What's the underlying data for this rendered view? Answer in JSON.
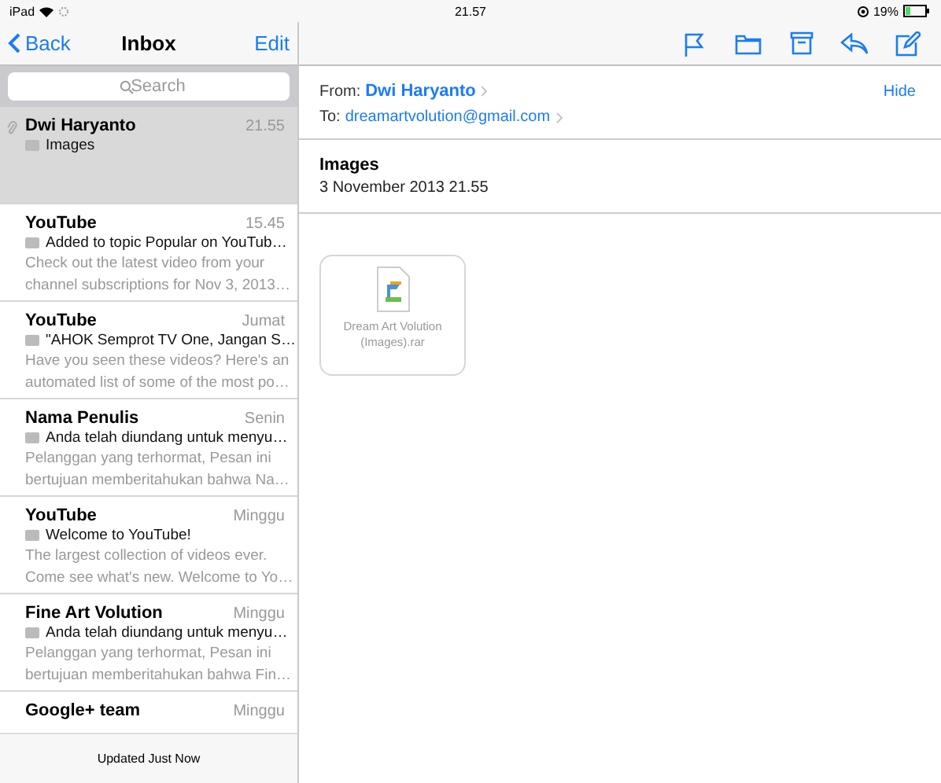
{
  "status_bar": {
    "device": "iPad",
    "time": "21.57",
    "battery": "19%"
  },
  "sidebar": {
    "back": "Back",
    "title": "Inbox",
    "edit": "Edit",
    "search": {
      "placeholder": "Search"
    },
    "messages": [
      {
        "sender": "Dwi Haryanto",
        "time": "21.55",
        "subject": "Images",
        "selected": true,
        "attachment": true
      },
      {
        "sender": "YouTube",
        "time": "15.45",
        "subject": "Added to topic Popular on YouTub…",
        "preview": [
          "Check out the latest video from your",
          "channel subscriptions for Nov 3, 2013…"
        ],
        "selected": false,
        "attachment": false
      },
      {
        "sender": "YouTube",
        "time": "Jumat",
        "subject": "\"AHOK Semprot TV One, Jangan S…",
        "preview": [
          "Have you seen these videos? Here's an",
          "automated list of some of the most po…"
        ],
        "selected": false,
        "attachment": false
      },
      {
        "sender": "Nama Penulis",
        "time": "Senin",
        "subject": "Anda telah diundang untuk menyu…",
        "preview": [
          "Pelanggan yang terhormat, Pesan ini",
          "bertujuan memberitahukan bahwa Na…"
        ],
        "selected": false,
        "attachment": false
      },
      {
        "sender": "YouTube",
        "time": "Minggu",
        "subject": "Welcome to YouTube!",
        "preview": [
          "The largest collection of videos ever.",
          "Come see what's new. Welcome to Yo…"
        ],
        "selected": false,
        "attachment": false
      },
      {
        "sender": "Fine Art Volution",
        "time": "Minggu",
        "subject": "Anda telah diundang untuk menyu…",
        "preview": [
          "Pelanggan yang terhormat, Pesan ini",
          "bertujuan memberitahukan bahwa Fin…"
        ],
        "selected": false,
        "attachment": false
      },
      {
        "sender": "Google+ team",
        "time": "Minggu",
        "selected": false,
        "attachment": false
      }
    ],
    "footer": "Updated Just Now"
  },
  "message": {
    "from_label": "From:",
    "from": "Dwi Haryanto",
    "hide": "Hide",
    "to_label": "To:",
    "to": "dreamartvolution@gmail.com",
    "subject": "Images",
    "date": "3 November 2013 21.55",
    "attachment": {
      "name": "Dream Art Volution (Images).rar"
    }
  }
}
